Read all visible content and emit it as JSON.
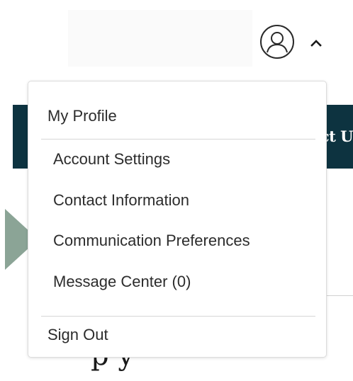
{
  "header": {
    "avatar_icon": "user-circle-icon",
    "chevron_icon": "chevron-up-icon"
  },
  "background": {
    "band_text": "ct U",
    "large_text": "p    y"
  },
  "menu": {
    "my_profile": "My Profile",
    "items": [
      {
        "label": "Account Settings"
      },
      {
        "label": "Contact Information"
      },
      {
        "label": "Communication Preferences"
      },
      {
        "label": "Message Center (0)"
      }
    ],
    "sign_out": "Sign Out"
  },
  "colors": {
    "dark_band": "#0d3340",
    "arrow": "#8ba496",
    "text": "#2c2c2c",
    "divider": "#d6d6d6"
  }
}
